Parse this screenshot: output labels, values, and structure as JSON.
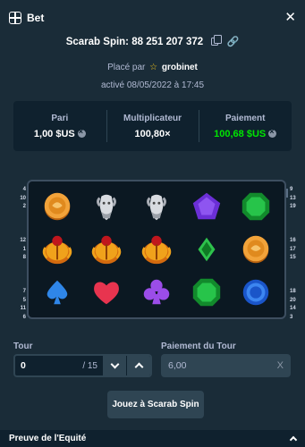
{
  "header": {
    "title": "Bet"
  },
  "bet": {
    "id_line": "Scarab Spin: 88 251 207 372",
    "placed_by_prefix": "Placé par",
    "user": "grobinet",
    "active_line": "activé 08/05/2022 à 17:45"
  },
  "stats": {
    "bet_label": "Pari",
    "bet_value": "1,00 $US",
    "multiplier_label": "Multiplicateur",
    "multiplier_value": "100,80×",
    "payout_label": "Paiement",
    "payout_value": "100,68 $US"
  },
  "paylines": {
    "left": [
      "4",
      "10",
      "2",
      "",
      "",
      "",
      "12",
      "1",
      "8",
      "",
      "",
      "",
      "7",
      "5",
      "11",
      "6"
    ],
    "right": [
      "9",
      "13",
      "19",
      "",
      "",
      "",
      "16",
      "17",
      "15",
      "",
      "",
      "",
      "18",
      "20",
      "14",
      "3"
    ]
  },
  "reels": {
    "symbols": [
      [
        "coin",
        "ram",
        "ram",
        "pentagon",
        "emerald"
      ],
      [
        "scarab",
        "scarab",
        "scarab",
        "diamond",
        "coin"
      ],
      [
        "spade",
        "heart",
        "club",
        "emerald",
        "ring"
      ]
    ]
  },
  "controls": {
    "tour_label": "Tour",
    "tour_value": "0",
    "tour_total": "/ 15",
    "payout_tour_label": "Paiement du Tour",
    "payout_tour_value": "6,00",
    "payout_clear": "X",
    "play_label": "Jouez à Scarab Spin"
  },
  "footer": {
    "title": "Preuve de l'Equité"
  },
  "colors": {
    "payout_green": "#00e701",
    "background": "#1a2c38",
    "panel": "#0f212e",
    "star": "#f5c518"
  }
}
